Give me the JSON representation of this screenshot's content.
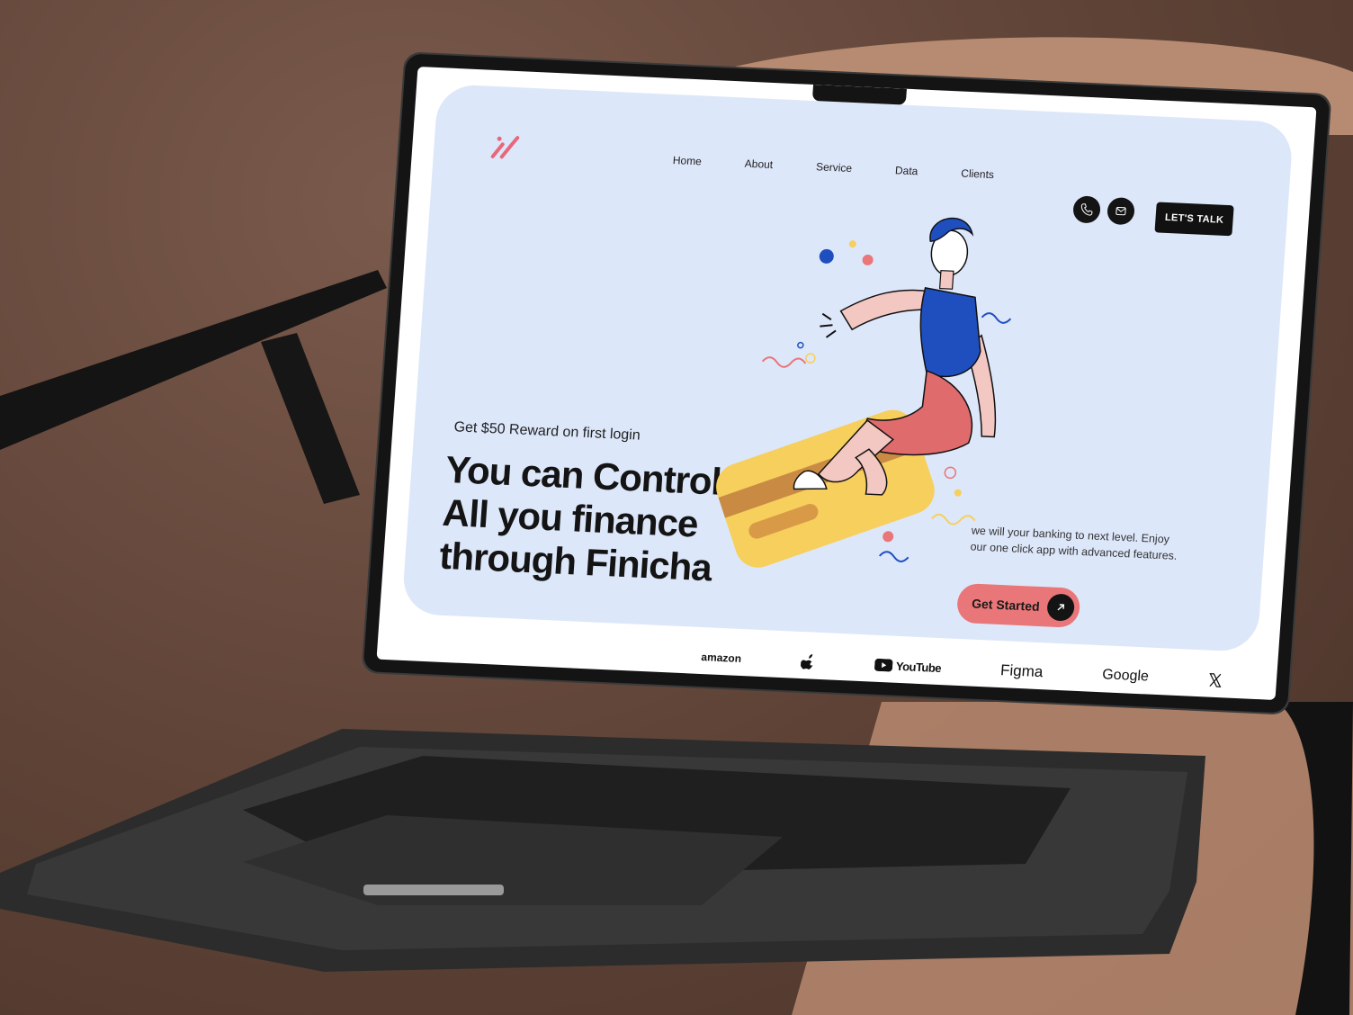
{
  "nav": {
    "items": [
      "Home",
      "About",
      "Service",
      "Data",
      "Clients"
    ],
    "cta_label": "LET'S TALK"
  },
  "hero": {
    "reward_text": "Get $50 Reward on first login",
    "headline": "You can Control All you finance through Finicha",
    "description": "we will your banking to next level. Enjoy our one click app with advanced features.",
    "cta_label": "Get Started"
  },
  "brands": {
    "amazon": "amazon",
    "youtube": "YouTube",
    "figma": "Figma",
    "google": "Google"
  },
  "colors": {
    "hero_bg": "#dde7fa",
    "accent_coral": "#e97678",
    "dark": "#141414",
    "figure_blue": "#1f4fbf",
    "card_yellow": "#f6cf5c"
  },
  "icons": [
    "logo-mark-icon",
    "phone-icon",
    "mail-icon",
    "arrow-up-right-icon",
    "apple-logo-icon",
    "youtube-play-icon",
    "x-logo-icon"
  ]
}
